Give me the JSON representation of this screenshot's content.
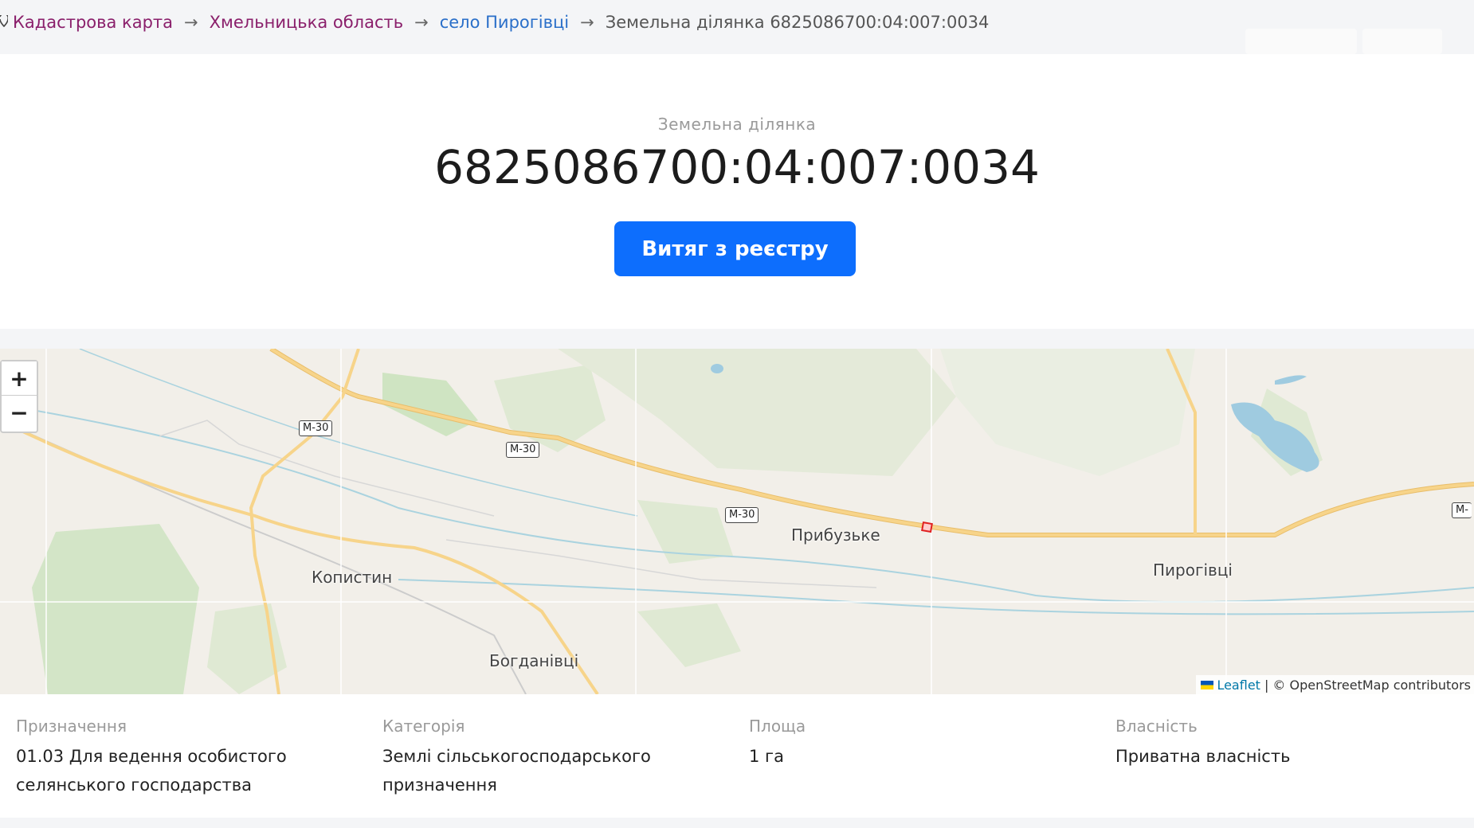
{
  "breadcrumb": {
    "items": [
      {
        "label": "Кадастрова карта"
      },
      {
        "label": "Хмельницька область"
      },
      {
        "label": "село Пирогівці"
      }
    ],
    "separator": "→",
    "current": "Земельна ділянка 6825086700:04:007:0034"
  },
  "header": {
    "subtitle": "Земельна ділянка",
    "title": "6825086700:04:007:0034",
    "button_label": "Витяг з реєстру"
  },
  "map": {
    "zoom_in": "+",
    "zoom_out": "−",
    "places": {
      "prybuzke": "Прибузьке",
      "pyrohivtsi": "Пирогівці",
      "kopystyn": "Копистин",
      "bohdanivtsi": "Богданівці"
    },
    "road_label": "М-30",
    "road_label_cut": "М-",
    "attribution": {
      "link": "Leaflet",
      "text": "| © OpenStreetMap contributors"
    },
    "colors": {
      "background": "#f2efe9",
      "road": "#f7d48a",
      "water": "#aad3df",
      "forest": "#dfe9d3",
      "parcel": "#e02020"
    }
  },
  "info": {
    "purpose": {
      "label": "Призначення",
      "value": "01.03 Для ведення особистого селянського господарства"
    },
    "category": {
      "label": "Категорія",
      "value": "Землі сільськогосподарського призначення"
    },
    "area": {
      "label": "Площа",
      "value": "1 га"
    },
    "ownership": {
      "label": "Власність",
      "value": "Приватна власність"
    }
  },
  "colors": {
    "accent": "#0d6efd",
    "breadcrumb_link": "#8a1f6b",
    "breadcrumb_active_link": "#2a6fc9"
  }
}
